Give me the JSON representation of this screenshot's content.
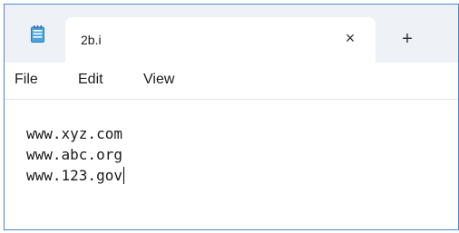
{
  "tab": {
    "title": "2b.i",
    "close_glyph": "×",
    "icon": "notepad-icon"
  },
  "new_tab_glyph": "+",
  "menu": {
    "items": [
      "File",
      "Edit",
      "View"
    ]
  },
  "editor": {
    "lines": [
      "www.xyz.com",
      "www.abc.org",
      "www.123.gov"
    ]
  },
  "colors": {
    "window_border": "#4a88c8",
    "titlebar_bg": "#eef1f6",
    "app_icon": "#4aa3df"
  }
}
